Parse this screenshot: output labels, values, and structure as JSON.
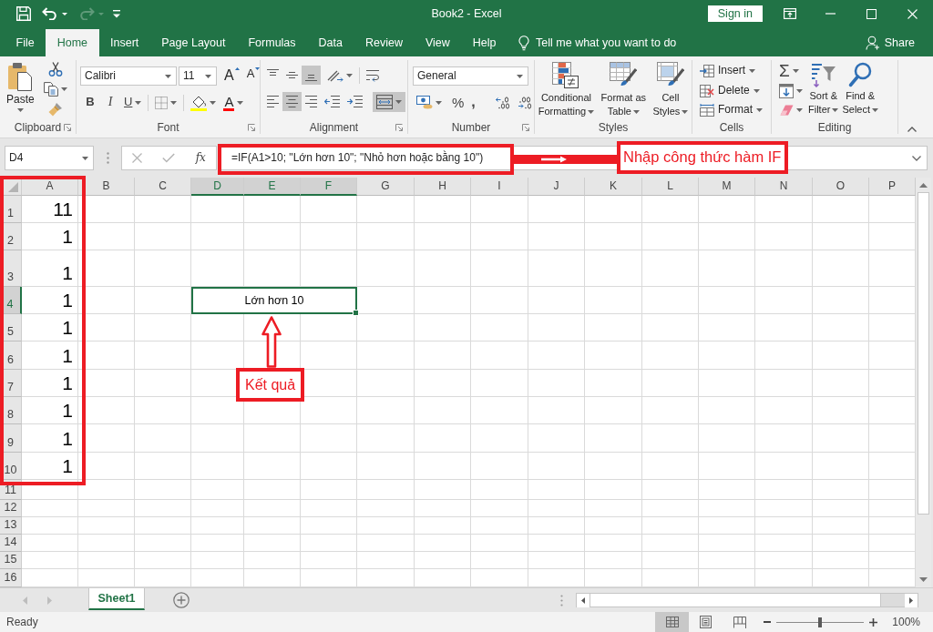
{
  "window": {
    "title": "Book2 - Excel",
    "sign_in": "Sign in"
  },
  "quick_access": [
    {
      "kind": "save",
      "disabled": false
    },
    {
      "kind": "undo",
      "disabled": false
    },
    {
      "kind": "redo",
      "disabled": true
    }
  ],
  "ribbon_tabs": [
    {
      "label": "File",
      "selected": false
    },
    {
      "label": "Home",
      "selected": true
    },
    {
      "label": "Insert",
      "selected": false
    },
    {
      "label": "Page Layout",
      "selected": false
    },
    {
      "label": "Formulas",
      "selected": false
    },
    {
      "label": "Data",
      "selected": false
    },
    {
      "label": "Review",
      "selected": false
    },
    {
      "label": "View",
      "selected": false
    },
    {
      "label": "Help",
      "selected": false
    }
  ],
  "tell_me": "Tell me what you want to do",
  "share": "Share",
  "ribbon": {
    "clipboard": {
      "label": "Clipboard",
      "paste": "Paste"
    },
    "font": {
      "label": "Font",
      "font_name": "Calibri",
      "font_size": "11",
      "grow": "A",
      "shrink": "A",
      "styles": [
        {
          "kind": "bold",
          "glyph": "B"
        },
        {
          "kind": "italic",
          "glyph": "I"
        },
        {
          "kind": "underline",
          "glyph": "U"
        }
      ],
      "font_color": "A"
    },
    "alignment": {
      "label": "Alignment",
      "vertical": [
        {
          "kind": "top",
          "selected": false
        },
        {
          "kind": "middle",
          "selected": false
        },
        {
          "kind": "bottom",
          "selected": true
        }
      ],
      "horizontal": [
        {
          "kind": "left",
          "selected": false
        },
        {
          "kind": "center",
          "selected": true
        },
        {
          "kind": "right",
          "selected": false
        }
      ],
      "merge_and_center": {
        "selected": true
      }
    },
    "number": {
      "label": "Number",
      "format": "General",
      "percent": "%",
      "comma": ","
    },
    "styles": {
      "label": "Styles",
      "buttons": [
        {
          "kind": "conditional",
          "lines": [
            "Conditional",
            "Formatting"
          ]
        },
        {
          "kind": "table",
          "lines": [
            "Format as",
            "Table"
          ]
        },
        {
          "kind": "cell_styles",
          "lines": [
            "Cell",
            "Styles"
          ]
        }
      ]
    },
    "cells": {
      "label": "Cells",
      "buttons": [
        {
          "kind": "insert",
          "label": "Insert"
        },
        {
          "kind": "delete",
          "label": "Delete"
        },
        {
          "kind": "format",
          "label": "Format"
        }
      ]
    },
    "editing": {
      "label": "Editing",
      "autosum": "Σ",
      "buttons": [
        {
          "kind": "sort",
          "lines": [
            "Sort &",
            "Filter"
          ]
        },
        {
          "kind": "find",
          "lines": [
            "Find &",
            "Select"
          ]
        }
      ]
    }
  },
  "formula_bar": {
    "name_box": "D4",
    "function_button": "fx",
    "formula": "=IF(A1>10; \"Lớn hơn 10\"; \"Nhỏ hơn hoặc bằng 10\")"
  },
  "sheet": {
    "columns": [
      {
        "label": "A",
        "selected": false
      },
      {
        "label": "B",
        "selected": false
      },
      {
        "label": "C",
        "selected": false
      },
      {
        "label": "D",
        "selected": true
      },
      {
        "label": "E",
        "selected": true
      },
      {
        "label": "F",
        "selected": true
      },
      {
        "label": "G",
        "selected": false
      },
      {
        "label": "H",
        "selected": false
      },
      {
        "label": "I",
        "selected": false
      },
      {
        "label": "J",
        "selected": false
      },
      {
        "label": "K",
        "selected": false
      },
      {
        "label": "L",
        "selected": false
      },
      {
        "label": "M",
        "selected": false
      },
      {
        "label": "N",
        "selected": false
      },
      {
        "label": "O",
        "selected": false
      },
      {
        "label": "P",
        "selected": false
      }
    ],
    "rows": [
      {
        "label": "1",
        "selected": false,
        "cells": [
          {
            "kind": "number",
            "value": "11",
            "selected": false
          }
        ]
      },
      {
        "label": "2",
        "selected": false,
        "cells": [
          {
            "kind": "number",
            "value": "1",
            "selected": false
          }
        ]
      },
      {
        "label": "3",
        "selected": false,
        "cells": [
          {
            "kind": "number",
            "value": "1",
            "selected": false
          }
        ]
      },
      {
        "label": "4",
        "selected": true,
        "cells": [
          {
            "kind": "number",
            "value": "1",
            "selected": false
          },
          {
            "kind": "merged",
            "value": "Lớn hơn 10",
            "selected": true
          }
        ]
      },
      {
        "label": "5",
        "selected": false,
        "cells": [
          {
            "kind": "number",
            "value": "1",
            "selected": false
          }
        ]
      },
      {
        "label": "6",
        "selected": false,
        "cells": [
          {
            "kind": "number",
            "value": "1",
            "selected": false
          }
        ]
      },
      {
        "label": "7",
        "selected": false,
        "cells": [
          {
            "kind": "number",
            "value": "1",
            "selected": false
          }
        ]
      },
      {
        "label": "8",
        "selected": false,
        "cells": [
          {
            "kind": "number",
            "value": "1",
            "selected": false
          }
        ]
      },
      {
        "label": "9",
        "selected": false,
        "cells": [
          {
            "kind": "number",
            "value": "1",
            "selected": false
          }
        ]
      },
      {
        "label": "10",
        "selected": false,
        "cells": [
          {
            "kind": "number",
            "value": "1",
            "selected": false
          }
        ]
      },
      {
        "label": "11",
        "selected": false
      },
      {
        "label": "12",
        "selected": false
      },
      {
        "label": "13",
        "selected": false
      },
      {
        "label": "14",
        "selected": false
      },
      {
        "label": "15",
        "selected": false
      },
      {
        "label": "16",
        "selected": false
      }
    ]
  },
  "sheet_tabs": [
    {
      "label": "Sheet1",
      "selected": true
    }
  ],
  "status_bar": {
    "status": "Ready",
    "views": [
      {
        "kind": "normal",
        "selected": true
      },
      {
        "kind": "page_layout",
        "selected": false
      },
      {
        "kind": "page_break",
        "selected": false
      }
    ],
    "zoom": {
      "level": 0.5,
      "reading": "100%"
    }
  },
  "annotations": {
    "formula_note": "Nhập công thức hàm IF",
    "result_note": "Kết quả"
  }
}
